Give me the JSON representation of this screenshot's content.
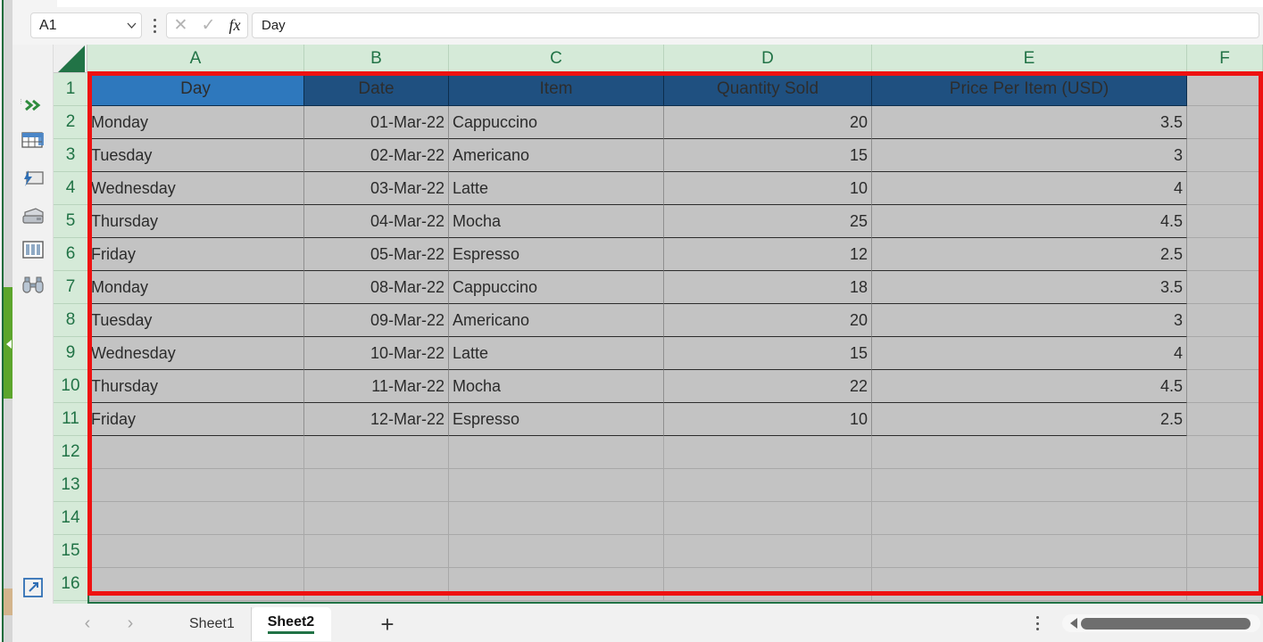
{
  "app": {
    "name_box_value": "A1",
    "formula_value": "Day",
    "cancel_icon": "x-icon",
    "confirm_icon": "check-icon",
    "function_icon": "fx-icon"
  },
  "rail": {
    "items": [
      {
        "name": "expand-chevrons-icon",
        "label": "»"
      },
      {
        "name": "spreadsheet-icon",
        "label": ""
      },
      {
        "name": "presentation-icon",
        "label": ""
      },
      {
        "name": "printer-icon",
        "label": ""
      },
      {
        "name": "columns-icon",
        "label": ""
      },
      {
        "name": "binoculars-icon",
        "label": ""
      }
    ],
    "bottom_items": [
      {
        "name": "popout-icon",
        "label": ""
      },
      {
        "name": "settings-gear-icon",
        "label": ""
      }
    ]
  },
  "grid": {
    "columns": [
      "A",
      "B",
      "C",
      "D",
      "E",
      "F"
    ],
    "rows": [
      "1",
      "2",
      "3",
      "4",
      "5",
      "6",
      "7",
      "8",
      "9",
      "10",
      "11",
      "12",
      "13",
      "14",
      "15",
      "16"
    ],
    "headers": [
      "Day",
      "Date",
      "Item",
      "Quantity Sold",
      "Price Per Item (USD)"
    ],
    "active_cell": "A1",
    "data": [
      [
        "Monday",
        "01-Mar-22",
        "Cappuccino",
        "20",
        "3.5"
      ],
      [
        "Tuesday",
        "02-Mar-22",
        "Americano",
        "15",
        "3"
      ],
      [
        "Wednesday",
        "03-Mar-22",
        "Latte",
        "10",
        "4"
      ],
      [
        "Thursday",
        "04-Mar-22",
        "Mocha",
        "25",
        "4.5"
      ],
      [
        "Friday",
        "05-Mar-22",
        "Espresso",
        "12",
        "2.5"
      ],
      [
        "Monday",
        "08-Mar-22",
        "Cappuccino",
        "18",
        "3.5"
      ],
      [
        "Tuesday",
        "09-Mar-22",
        "Americano",
        "20",
        "3"
      ],
      [
        "Wednesday",
        "10-Mar-22",
        "Latte",
        "15",
        "4"
      ],
      [
        "Thursday",
        "11-Mar-22",
        "Mocha",
        "22",
        "4.5"
      ],
      [
        "Friday",
        "12-Mar-22",
        "Espresso",
        "10",
        "2.5"
      ]
    ]
  },
  "footer": {
    "prev_sheet_icon": "chevron-left-icon",
    "next_sheet_icon": "chevron-right-icon",
    "tabs": [
      {
        "label": "Sheet1",
        "active": false
      },
      {
        "label": "Sheet2",
        "active": true
      }
    ],
    "add_sheet_label": "+",
    "menu_icon": "kebab-menu-icon",
    "scroll_left_icon": "scroll-left-arrow-icon"
  },
  "colors": {
    "header_fill": "#1f5080",
    "header_active_fill": "#2e78bd",
    "cell_fill": "#c3c3c3",
    "selection_green": "#217346",
    "annotation_red": "#ee1111",
    "row_header_fill": "#d5ead8"
  }
}
